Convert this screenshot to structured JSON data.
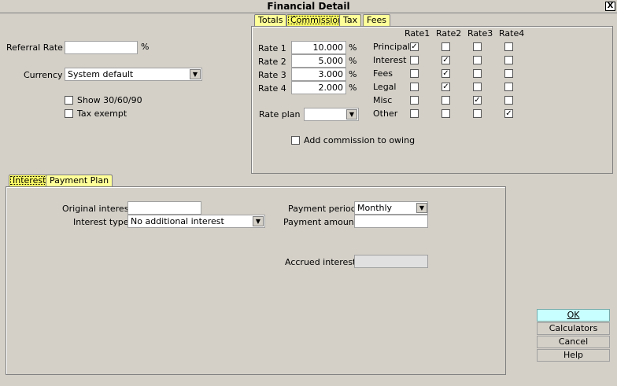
{
  "window": {
    "title": "Financial Detail",
    "close_glyph": "X"
  },
  "left": {
    "referral_rate_label": "Referral Rate",
    "referral_rate_value": "",
    "percent_sign": "%",
    "currency_label": "Currency",
    "currency_value": "System default",
    "show_306090_label": "Show 30/60/90",
    "tax_exempt_label": "Tax exempt"
  },
  "top_tabs": [
    {
      "label": "Totals"
    },
    {
      "label": "Commission"
    },
    {
      "label": "Tax"
    },
    {
      "label": "Fees"
    }
  ],
  "commission": {
    "rate_columns": [
      "Rate1",
      "Rate2",
      "Rate3",
      "Rate4"
    ],
    "rates": [
      {
        "label": "Rate 1",
        "value": "10.000",
        "pct": "%"
      },
      {
        "label": "Rate 2",
        "value": "5.000",
        "pct": "%"
      },
      {
        "label": "Rate 3",
        "value": "3.000",
        "pct": "%"
      },
      {
        "label": "Rate 4",
        "value": "2.000",
        "pct": "%"
      }
    ],
    "categories": [
      {
        "label": "Principal",
        "checks": [
          true,
          false,
          false,
          false
        ]
      },
      {
        "label": "Interest",
        "checks": [
          false,
          true,
          false,
          false
        ]
      },
      {
        "label": "Fees",
        "checks": [
          false,
          true,
          false,
          false
        ]
      },
      {
        "label": "Legal",
        "checks": [
          false,
          true,
          false,
          false
        ]
      },
      {
        "label": "Misc",
        "checks": [
          false,
          false,
          true,
          false
        ]
      },
      {
        "label": "Other",
        "checks": [
          false,
          false,
          false,
          true
        ]
      }
    ],
    "rate_plan_label": "Rate plan",
    "rate_plan_value": "",
    "add_to_owing_label": "Add commission to owing"
  },
  "bottom_tabs": [
    {
      "label": "Interest"
    },
    {
      "label": "Payment Plan"
    }
  ],
  "interest": {
    "original_interest_label": "Original interest",
    "original_interest_value": "",
    "interest_type_label": "Interest type",
    "interest_type_value": "No additional interest",
    "payment_period_label": "Payment period",
    "payment_period_value": "Monthly",
    "payment_amount_label": "Payment amount",
    "payment_amount_value": "",
    "accrued_interest_label": "Accrued interest",
    "accrued_interest_value": ""
  },
  "buttons": {
    "ok": "OK",
    "calculators": "Calculators",
    "cancel": "Cancel",
    "help": "Help"
  },
  "icons": {
    "dropdown": "chevron-down-icon",
    "check": "check-icon"
  }
}
